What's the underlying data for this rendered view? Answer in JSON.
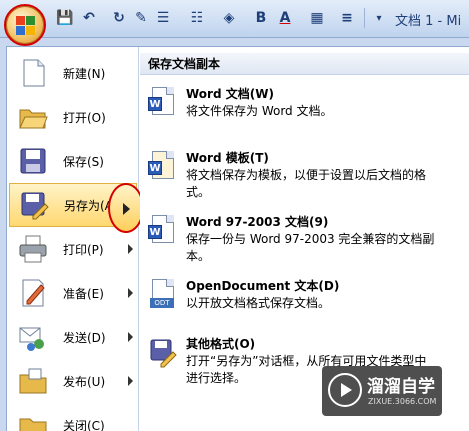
{
  "window": {
    "title": "文档 1 - Mi"
  },
  "quick_access": {
    "items": [
      {
        "name": "save",
        "glyph": "💾"
      },
      {
        "name": "undo",
        "glyph": "↶"
      },
      {
        "name": "redo",
        "glyph": "↻"
      },
      {
        "name": "format-painter",
        "glyph": "✎"
      },
      {
        "name": "bullets",
        "glyph": "☰"
      },
      {
        "name": "numbering",
        "glyph": "☷"
      },
      {
        "name": "shading",
        "glyph": "◈"
      },
      {
        "name": "bold",
        "glyph": "B"
      },
      {
        "name": "font-color",
        "glyph": "A"
      },
      {
        "name": "borders",
        "glyph": "▦"
      },
      {
        "name": "align",
        "glyph": "≡"
      }
    ]
  },
  "left_menu": {
    "items": [
      {
        "id": "new",
        "label": "新建(N)",
        "icon": "new-document-icon",
        "submenu": false
      },
      {
        "id": "open",
        "label": "打开(O)",
        "icon": "open-folder-icon",
        "submenu": false
      },
      {
        "id": "save",
        "label": "保存(S)",
        "icon": "save-icon",
        "submenu": false
      },
      {
        "id": "saveas",
        "label": "另存为(A)",
        "icon": "save-as-icon",
        "submenu": true,
        "active": true
      },
      {
        "id": "print",
        "label": "打印(P)",
        "icon": "printer-icon",
        "submenu": true
      },
      {
        "id": "prepare",
        "label": "准备(E)",
        "icon": "prepare-icon",
        "submenu": true
      },
      {
        "id": "send",
        "label": "发送(D)",
        "icon": "send-icon",
        "submenu": true
      },
      {
        "id": "publish",
        "label": "发布(U)",
        "icon": "publish-icon",
        "submenu": true
      },
      {
        "id": "close",
        "label": "关闭(C)",
        "icon": "close-folder-icon",
        "submenu": false
      }
    ]
  },
  "right_panel": {
    "header": "保存文档副本",
    "options": [
      {
        "id": "word-doc",
        "title": "Word 文档(W)",
        "desc": "将文件保存为 Word 文档。",
        "icon": "word-document-icon"
      },
      {
        "id": "word-template",
        "title": "Word 模板(T)",
        "desc": "将文档保存为模板，以便于设置以后文档的格式。",
        "icon": "word-template-icon"
      },
      {
        "id": "word-97",
        "title": "Word 97-2003 文档(9)",
        "desc": "保存一份与 Word 97-2003 完全兼容的文档副本。",
        "icon": "word-97-icon"
      },
      {
        "id": "odt",
        "title": "OpenDocument 文本(D)",
        "desc": "以开放文档格式保存文档。",
        "icon": "opendocument-icon"
      },
      {
        "id": "other",
        "title": "其他格式(O)",
        "desc": "打开“另存为”对话框，从所有可用文件类型中进行选择。",
        "icon": "other-formats-icon"
      }
    ]
  },
  "watermark": {
    "name": "溜溜自学",
    "url": "ZIXUE.3066.COM"
  },
  "colors": {
    "accent_highlight": "#ffd870",
    "annotation_red": "#d40000",
    "ribbon_blue": "#bfd3ee"
  }
}
